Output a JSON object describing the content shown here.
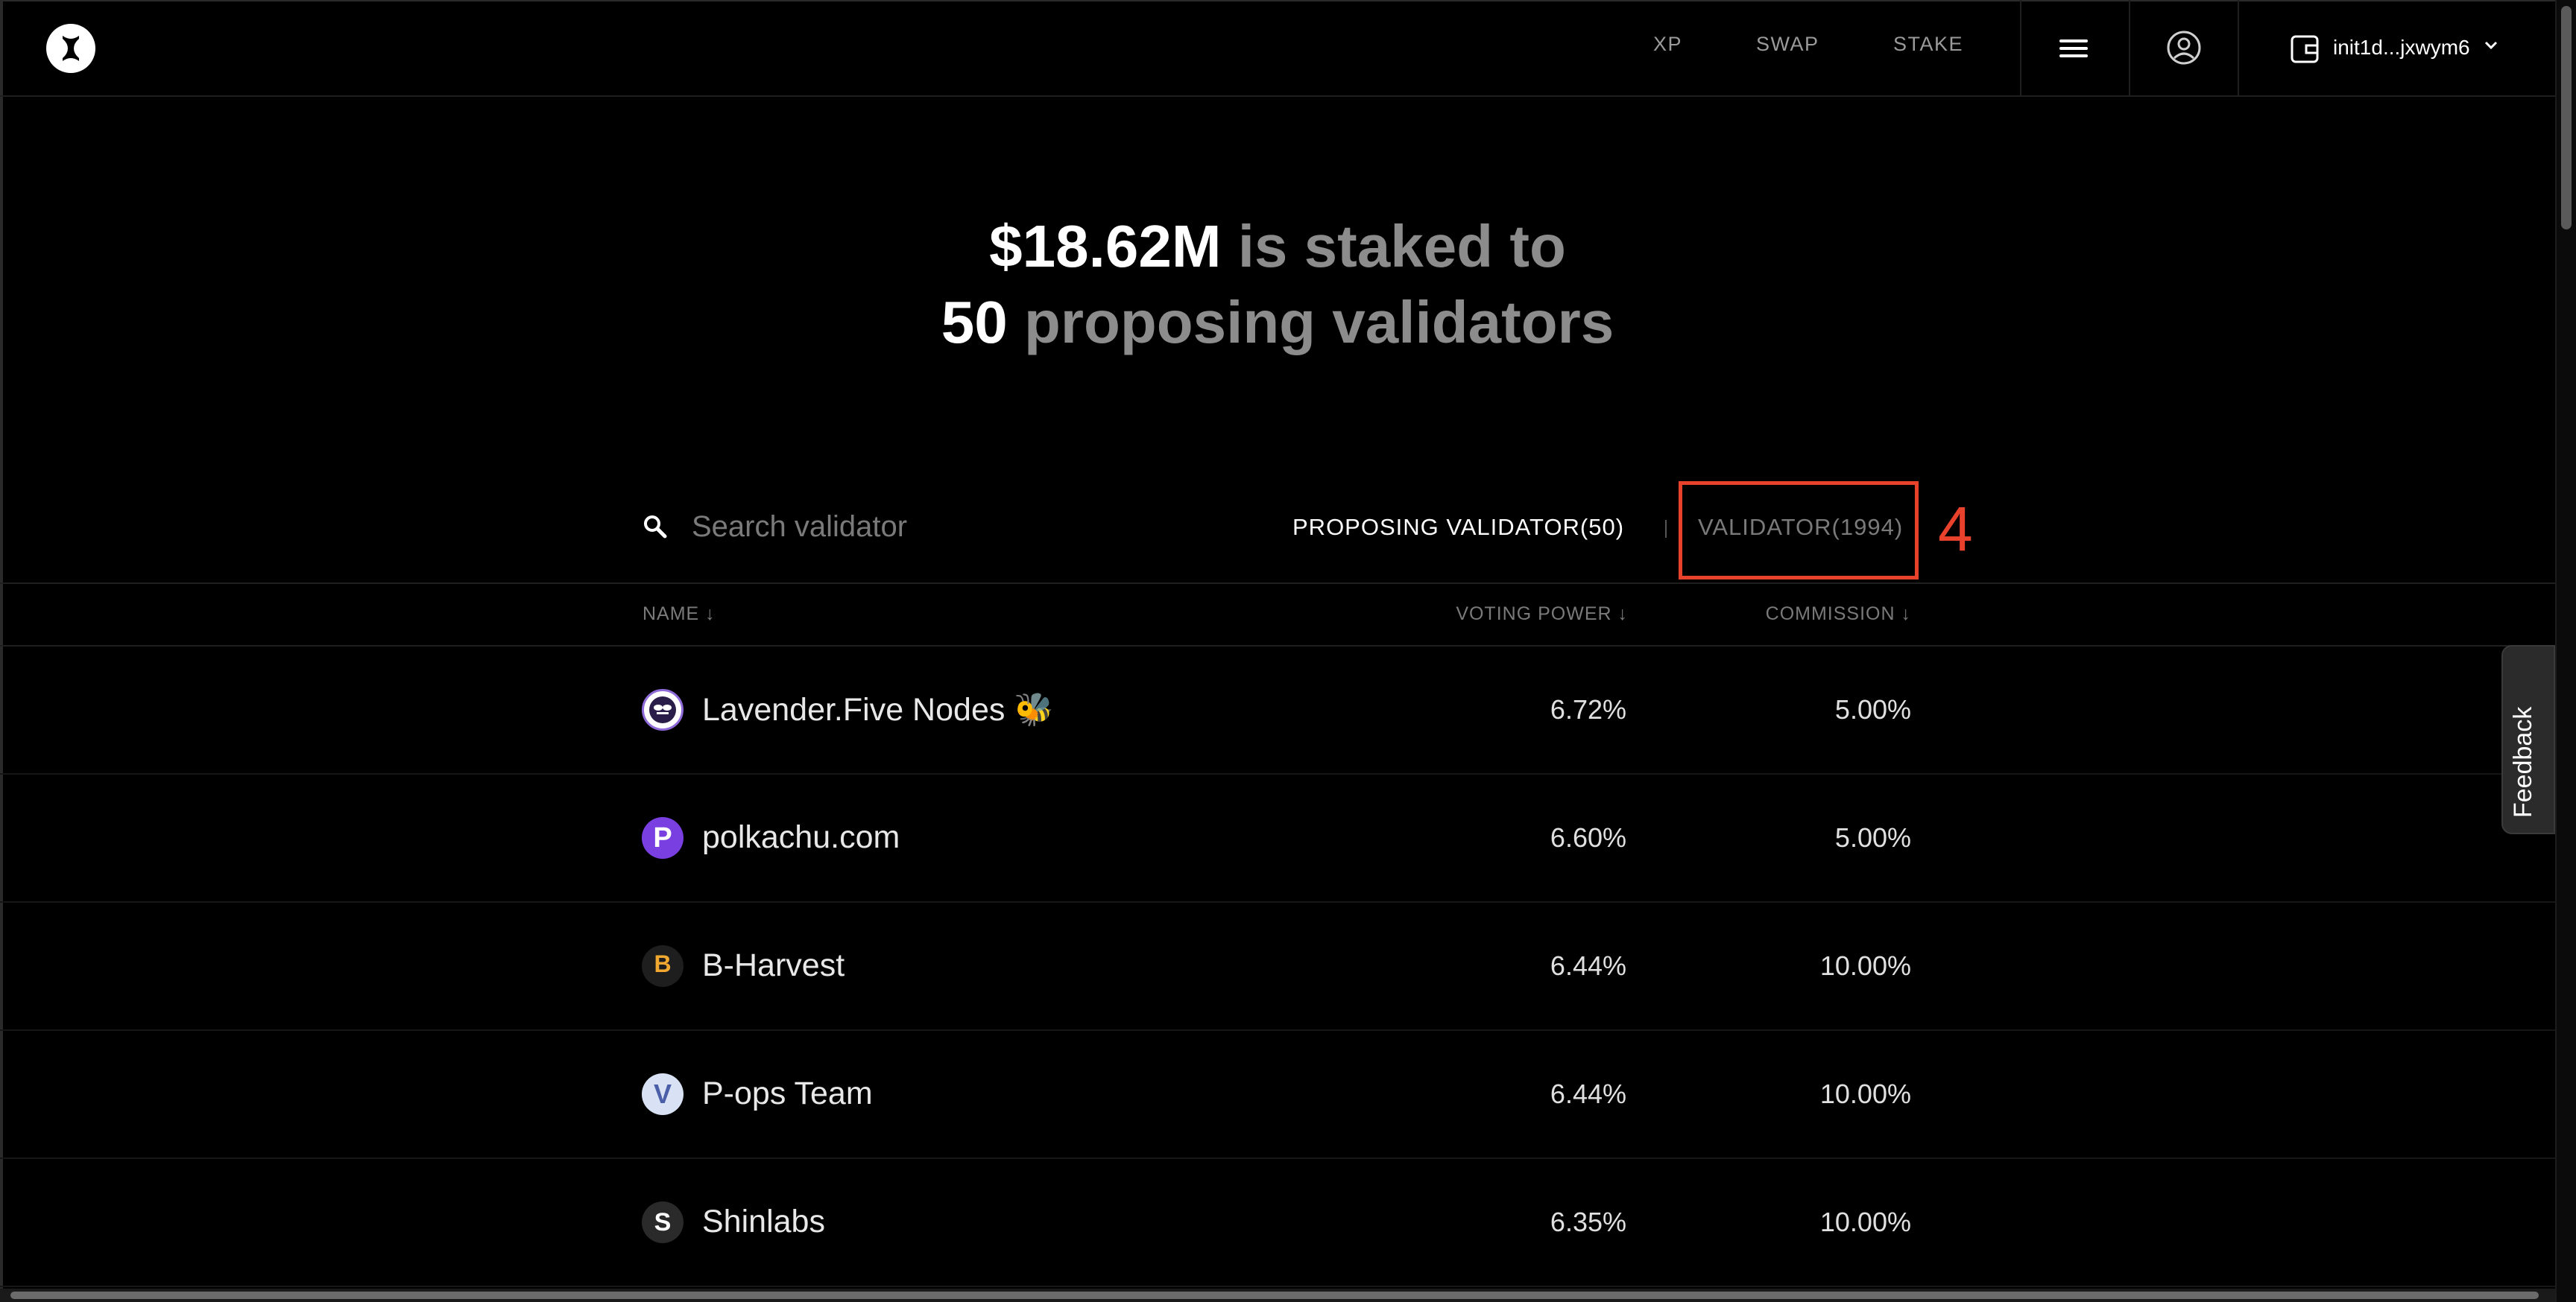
{
  "nav": {
    "links": [
      "XP",
      "SWAP",
      "STAKE"
    ],
    "wallet_label": "init1d...jxwym6"
  },
  "hero": {
    "amount": "$18.62M",
    "line1_rest": " is staked to",
    "count": "50",
    "line2_rest": " proposing validators"
  },
  "search": {
    "placeholder": "Search validator",
    "value": ""
  },
  "tabs": {
    "proposing": "PROPOSING VALIDATOR(50)",
    "all": "VALIDATOR(1994)"
  },
  "annotation": {
    "number": "4",
    "color": "#e8412c"
  },
  "table": {
    "headers": {
      "name": "NAME ↓",
      "voting_power": "VOTING POWER ↓",
      "commission": "COMMISSION ↓"
    },
    "rows": [
      {
        "name": "Lavender.Five Nodes 🐝",
        "avatar_icon": "bee-logo-icon",
        "voting_power": "6.72%",
        "commission": "5.00%"
      },
      {
        "name": "polkachu.com",
        "avatar_icon": "polkachu-logo-icon",
        "avatar_letter": "P",
        "voting_power": "6.60%",
        "commission": "5.00%"
      },
      {
        "name": "B-Harvest",
        "avatar_icon": "bharvest-logo-icon",
        "avatar_letter": "B",
        "voting_power": "6.44%",
        "commission": "10.00%"
      },
      {
        "name": "P-ops Team",
        "avatar_icon": "pops-logo-icon",
        "avatar_letter": "V",
        "voting_power": "6.44%",
        "commission": "10.00%"
      },
      {
        "name": "Shinlabs",
        "avatar_icon": "shinlabs-logo-icon",
        "avatar_letter": "S",
        "voting_power": "6.35%",
        "commission": "10.00%"
      }
    ]
  },
  "feedback": {
    "label": "Feedback"
  },
  "colors": {
    "background": "#000000",
    "muted_text": "#8c8c8c",
    "annotation": "#e8412c"
  }
}
